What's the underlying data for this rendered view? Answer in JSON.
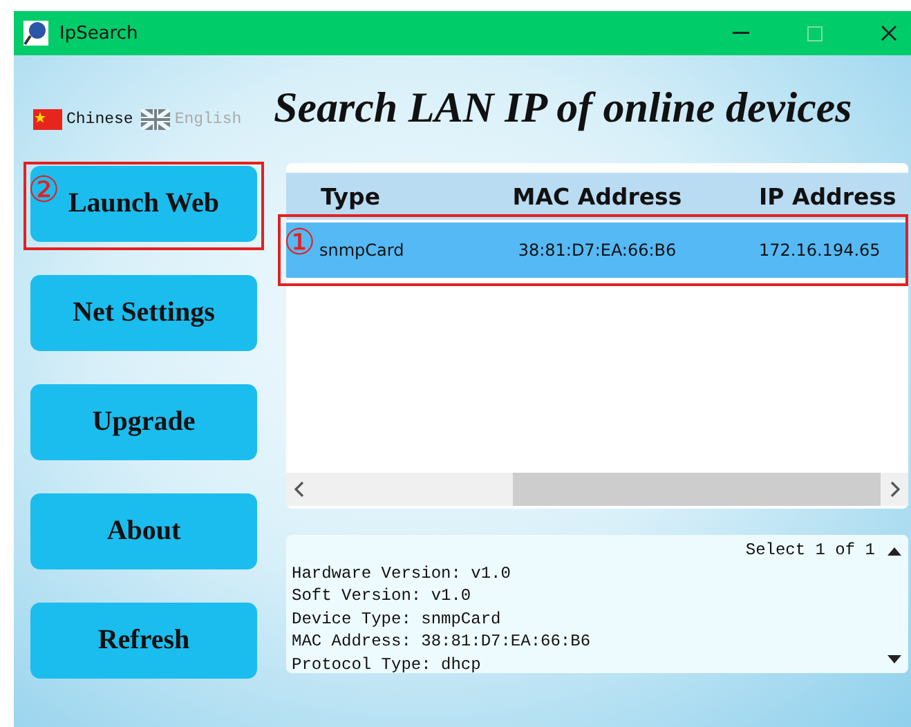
{
  "window": {
    "title": "IpSearch"
  },
  "languages": [
    {
      "label": "Chinese",
      "selected": true
    },
    {
      "label": "English",
      "selected": false
    }
  ],
  "heading": "Search LAN IP of online devices",
  "buttons": [
    {
      "label": "Launch Web"
    },
    {
      "label": "Net Settings"
    },
    {
      "label": "Upgrade"
    },
    {
      "label": "About"
    },
    {
      "label": "Refresh"
    }
  ],
  "table": {
    "columns": [
      "Type",
      "MAC Address",
      "IP Address"
    ],
    "rows": [
      {
        "cells": [
          "snmpCard",
          "38:81:D7:EA:66:B6",
          "172.16.194.65"
        ],
        "selected": true
      }
    ]
  },
  "info": {
    "counter": "Select 1 of 1",
    "lines": [
      "Hardware Version: v1.0",
      "Soft Version: v1.0",
      "Device Type: snmpCard",
      "MAC Address:  38:81:D7:EA:66:B6",
      "Protocol Type: dhcp"
    ]
  },
  "annotations": [
    {
      "kind": "button",
      "number": "②"
    },
    {
      "kind": "row",
      "number": "①"
    }
  ]
}
